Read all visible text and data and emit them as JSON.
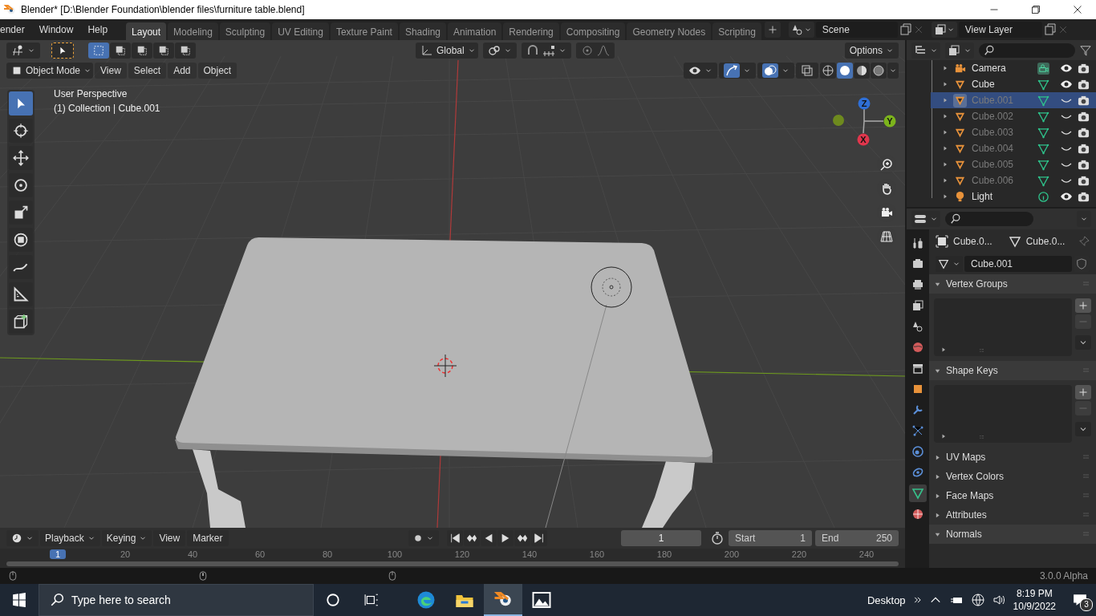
{
  "window": {
    "title": "Blender* [D:\\Blender Foundation\\blender files\\furniture table.blend]"
  },
  "menu": [
    "ender",
    "Window",
    "Help"
  ],
  "workspaces": [
    {
      "label": "Layout",
      "selected": true
    },
    {
      "label": "Modeling",
      "selected": false
    },
    {
      "label": "Sculpting",
      "selected": false
    },
    {
      "label": "UV Editing",
      "selected": false
    },
    {
      "label": "Texture Paint",
      "selected": false
    },
    {
      "label": "Shading",
      "selected": false
    },
    {
      "label": "Animation",
      "selected": false
    },
    {
      "label": "Rendering",
      "selected": false
    },
    {
      "label": "Compositing",
      "selected": false
    },
    {
      "label": "Geometry Nodes",
      "selected": false
    },
    {
      "label": "Scripting",
      "selected": false
    }
  ],
  "scene": {
    "value": "Scene"
  },
  "view_layer": {
    "value": "View Layer"
  },
  "viewport": {
    "orientation": "Global",
    "options": "Options",
    "mode": "Object Mode",
    "menus": [
      "View",
      "Select",
      "Add",
      "Object"
    ],
    "info": [
      "User Perspective",
      "(1) Collection | Cube.001"
    ],
    "axes": [
      {
        "label": "Z",
        "color": "#2f6fd6"
      },
      {
        "label": "Y",
        "color": "#7cb41c"
      },
      {
        "label": "X",
        "color": "#e0364c"
      }
    ],
    "tools": [
      {
        "kind": "select",
        "selected": true
      },
      {
        "kind": "cursor",
        "selected": false
      },
      {
        "kind": "move",
        "selected": false
      },
      {
        "kind": "rotate",
        "selected": false
      },
      {
        "kind": "scale",
        "selected": false
      },
      {
        "kind": "transform",
        "selected": false
      },
      {
        "kind": "annotate",
        "selected": false
      },
      {
        "kind": "measure",
        "selected": false
      },
      {
        "kind": "add-cube",
        "selected": false
      }
    ],
    "shading": [
      {
        "kind": "wireframe",
        "selected": false
      },
      {
        "kind": "solid",
        "selected": true
      },
      {
        "kind": "material",
        "selected": false
      },
      {
        "kind": "rendered",
        "selected": false
      }
    ]
  },
  "outliner": {
    "items": [
      {
        "name": "Camera",
        "kind": "camera",
        "visible": true,
        "selected": false
      },
      {
        "name": "Cube",
        "kind": "mesh",
        "visible": true,
        "selected": false
      },
      {
        "name": "Cube.001",
        "kind": "mesh",
        "visible": false,
        "selected": true
      },
      {
        "name": "Cube.002",
        "kind": "mesh",
        "visible": false,
        "selected": false
      },
      {
        "name": "Cube.003",
        "kind": "mesh",
        "visible": false,
        "selected": false
      },
      {
        "name": "Cube.004",
        "kind": "mesh",
        "visible": false,
        "selected": false
      },
      {
        "name": "Cube.005",
        "kind": "mesh",
        "visible": false,
        "selected": false
      },
      {
        "name": "Cube.006",
        "kind": "mesh",
        "visible": false,
        "selected": false
      },
      {
        "name": "Light",
        "kind": "light",
        "visible": true,
        "selected": false
      }
    ]
  },
  "properties": {
    "tabs": [
      {
        "kind": "tool",
        "selected": false
      },
      {
        "kind": "render",
        "selected": false
      },
      {
        "kind": "output",
        "selected": false
      },
      {
        "kind": "view-layer",
        "selected": false
      },
      {
        "kind": "scene",
        "selected": false
      },
      {
        "kind": "world",
        "selected": false
      },
      {
        "kind": "collection",
        "selected": false
      },
      {
        "kind": "object",
        "selected": false
      },
      {
        "kind": "modifier",
        "selected": false
      },
      {
        "kind": "particles",
        "selected": false
      },
      {
        "kind": "physics",
        "selected": false
      },
      {
        "kind": "constraints",
        "selected": false
      },
      {
        "kind": "data",
        "selected": true
      },
      {
        "kind": "material",
        "selected": false
      }
    ],
    "breadcrumb": [
      "Cube.0...",
      "Cube.0..."
    ],
    "mesh_name": "Cube.001",
    "panels": [
      {
        "title": "Vertex Groups",
        "expanded": true
      },
      {
        "title": "Shape Keys",
        "expanded": true
      },
      {
        "title": "UV Maps",
        "expanded": false
      },
      {
        "title": "Vertex Colors",
        "expanded": false
      },
      {
        "title": "Face Maps",
        "expanded": false
      },
      {
        "title": "Attributes",
        "expanded": false
      },
      {
        "title": "Normals",
        "expanded": true
      }
    ]
  },
  "timeline": {
    "menus": [
      "Playback",
      "Keying",
      "View",
      "Marker"
    ],
    "current_frame": "1",
    "start_label": "Start",
    "start": "1",
    "end_label": "End",
    "end": "250",
    "ruler": [
      "1",
      "20",
      "40",
      "60",
      "80",
      "100",
      "120",
      "140",
      "160",
      "180",
      "200",
      "220",
      "240"
    ]
  },
  "status": {
    "version": "3.0.0 Alpha"
  },
  "taskbar": {
    "search_placeholder": "Type here to search",
    "apps": [
      {
        "kind": "edge",
        "selected": false
      },
      {
        "kind": "explorer",
        "selected": false
      },
      {
        "kind": "blender",
        "selected": true
      },
      {
        "kind": "photos",
        "selected": false
      }
    ],
    "desktop": "Desktop",
    "time": "8:19 PM",
    "date": "10/9/2022",
    "notifications": "3"
  }
}
